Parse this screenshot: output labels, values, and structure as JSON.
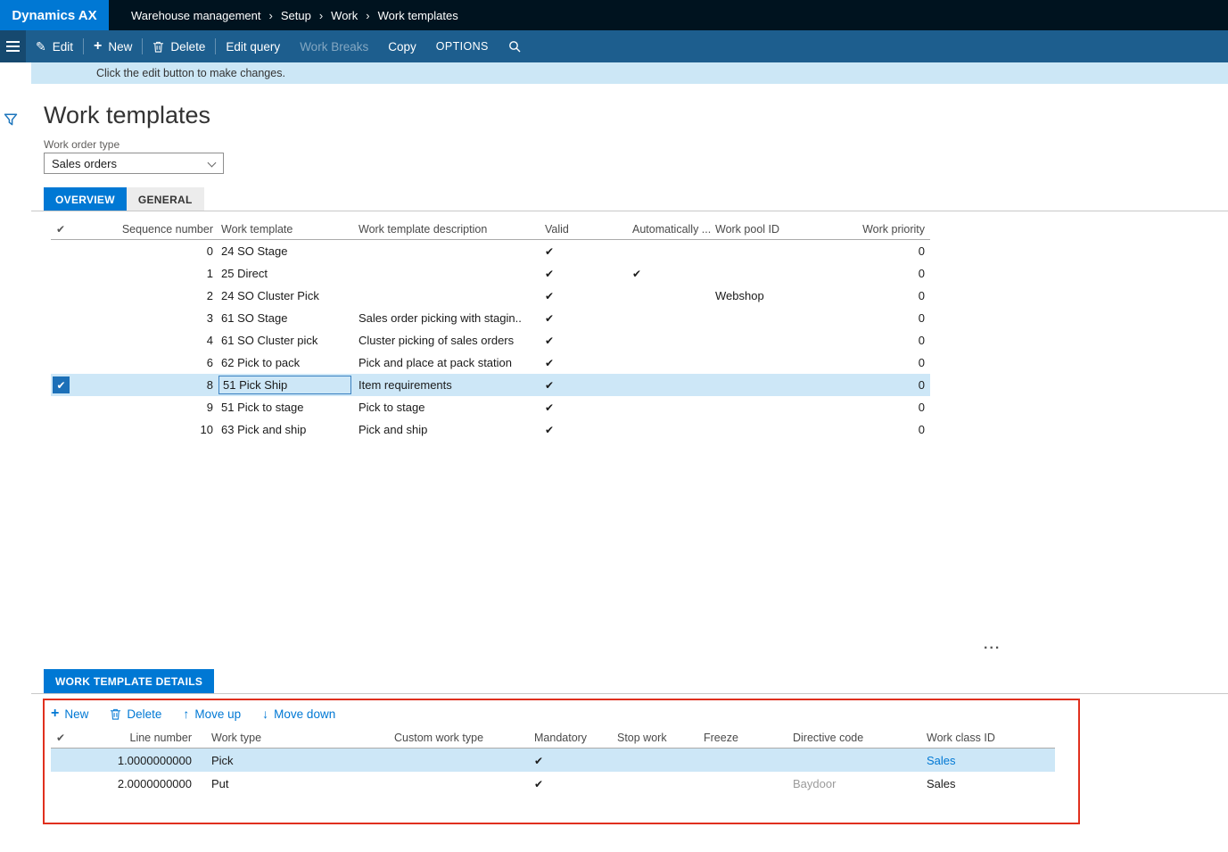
{
  "colors": {
    "accent": "#0078d4",
    "annotation_border": "#e0301e",
    "selection": "#cde7f7"
  },
  "topbar": {
    "logo": "Dynamics AX",
    "breadcrumbs": [
      "Warehouse management",
      "Setup",
      "Work",
      "Work templates"
    ]
  },
  "command_bar": {
    "edit": "Edit",
    "new": "New",
    "delete": "Delete",
    "edit_query": "Edit query",
    "work_breaks": "Work Breaks",
    "copy": "Copy",
    "options": "OPTIONS"
  },
  "notification": {
    "text": "Click the edit button to make changes."
  },
  "page": {
    "title": "Work templates",
    "work_order_type_label": "Work order type",
    "work_order_type_value": "Sales orders",
    "tabs": [
      {
        "label": "OVERVIEW"
      },
      {
        "label": "GENERAL"
      }
    ],
    "more": "..."
  },
  "overview": {
    "columns": [
      "Sequence number",
      "Work template",
      "Work template description",
      "Valid",
      "Automatically ...",
      "Work pool ID",
      "Work priority"
    ],
    "rows": [
      {
        "seq": "0",
        "template": "24 SO Stage",
        "description": "",
        "valid": true,
        "auto": false,
        "pool": "",
        "priority": "0",
        "selected": false
      },
      {
        "seq": "1",
        "template": "25 Direct",
        "description": "",
        "valid": true,
        "auto": true,
        "pool": "",
        "priority": "0",
        "selected": false
      },
      {
        "seq": "2",
        "template": "24 SO Cluster Pick",
        "description": "",
        "valid": true,
        "auto": false,
        "pool": "Webshop",
        "priority": "0",
        "selected": false
      },
      {
        "seq": "3",
        "template": "61 SO Stage",
        "description": "Sales order picking with stagin..",
        "valid": true,
        "auto": false,
        "pool": "",
        "priority": "0",
        "selected": false
      },
      {
        "seq": "4",
        "template": "61 SO Cluster pick",
        "description": "Cluster picking of sales orders",
        "valid": true,
        "auto": false,
        "pool": "",
        "priority": "0",
        "selected": false
      },
      {
        "seq": "6",
        "template": "62 Pick to pack",
        "description": "Pick and place at pack station",
        "valid": true,
        "auto": false,
        "pool": "",
        "priority": "0",
        "selected": false
      },
      {
        "seq": "8",
        "template": "51 Pick Ship",
        "description": "Item requirements",
        "valid": true,
        "auto": false,
        "pool": "",
        "priority": "0",
        "selected": true
      },
      {
        "seq": "9",
        "template": "51 Pick to stage",
        "description": "Pick to stage",
        "valid": true,
        "auto": false,
        "pool": "",
        "priority": "0",
        "selected": false
      },
      {
        "seq": "10",
        "template": "63 Pick and ship",
        "description": "Pick and ship",
        "valid": true,
        "auto": false,
        "pool": "",
        "priority": "0",
        "selected": false
      }
    ]
  },
  "details": {
    "tab_label": "WORK TEMPLATE DETAILS",
    "toolbar": {
      "new": "New",
      "delete": "Delete",
      "move_up": "Move up",
      "move_down": "Move down"
    },
    "columns": [
      "Line number",
      "Work type",
      "Custom work type",
      "Mandatory",
      "Stop work",
      "Freeze",
      "Directive code",
      "Work class ID"
    ],
    "rows": [
      {
        "line": "1.0000000000",
        "work_type": "Pick",
        "custom": "",
        "mandatory": true,
        "stop_work": "",
        "freeze": "",
        "directive": "",
        "work_class": "Sales",
        "selected": true
      },
      {
        "line": "2.0000000000",
        "work_type": "Put",
        "custom": "",
        "mandatory": true,
        "stop_work": "",
        "freeze": "",
        "directive": "Baydoor",
        "work_class": "Sales",
        "selected": false
      }
    ]
  }
}
